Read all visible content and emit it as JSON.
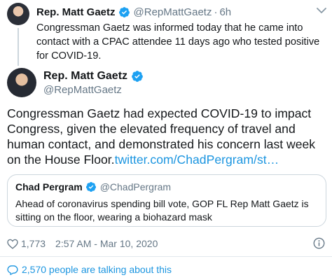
{
  "parent_tweet": {
    "name": "Rep. Matt Gaetz",
    "handle": "@RepMattGaetz",
    "separator": "·",
    "time": "6h",
    "text": "Congressman Gaetz was informed today that he came into contact with a CPAC attendee 11 days ago who tested positive for COVID-19."
  },
  "main_tweet": {
    "name": "Rep. Matt Gaetz",
    "handle": "@RepMattGaetz",
    "text": "Congressman Gaetz had expected COVID-19 to impact Congress, given the elevated frequency of travel and human contact, and demonstrated his concern last week on the House Floor.",
    "link": "twitter.com/ChadPergram/st…",
    "like_count": "1,773",
    "timestamp": "2:57 AM - Mar 10, 2020",
    "talking": "2,570 people are talking about this"
  },
  "quoted_tweet": {
    "name": "Chad Pergram",
    "handle": "@ChadPergram",
    "text": "Ahead of coronavirus spending bill vote, GOP FL Rep Matt Gaetz is sitting on the floor, wearing a biohazard mask"
  },
  "icons": {
    "verified": "verified-badge-icon",
    "caret": "chevron-down-icon",
    "like": "heart-icon",
    "info": "info-icon",
    "reply": "speech-bubble-icon"
  },
  "colors": {
    "accent": "#1b95e0",
    "verified": "#1da1f2",
    "secondary_text": "#657786"
  }
}
